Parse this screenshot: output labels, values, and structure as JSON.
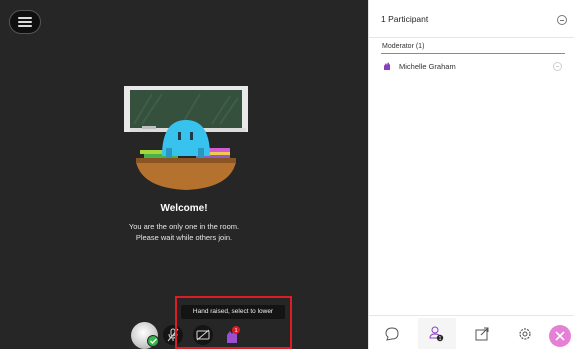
{
  "session": {
    "welcome_title": "Welcome!",
    "welcome_line1": "You are the only one in the room.",
    "welcome_line2": "Please wait while others join.",
    "tooltip": "Hand raised, select to lower",
    "raised_hand_count": "1"
  },
  "panel": {
    "title": "1 Participant",
    "section_label": "Moderator (1)",
    "participants": [
      {
        "name": "Michelle Graham",
        "role": "moderator"
      }
    ],
    "footer_tabs": [
      "chat-icon",
      "participants-icon",
      "share-content-icon",
      "settings-icon",
      "close-icon"
    ],
    "participants_badge": "1"
  },
  "colors": {
    "stage_bg": "#262626",
    "accent_purple": "#8a3fbf",
    "close_button": "#e67fd6",
    "highlight_border": "#d91e26",
    "status_green": "#36b34a"
  }
}
